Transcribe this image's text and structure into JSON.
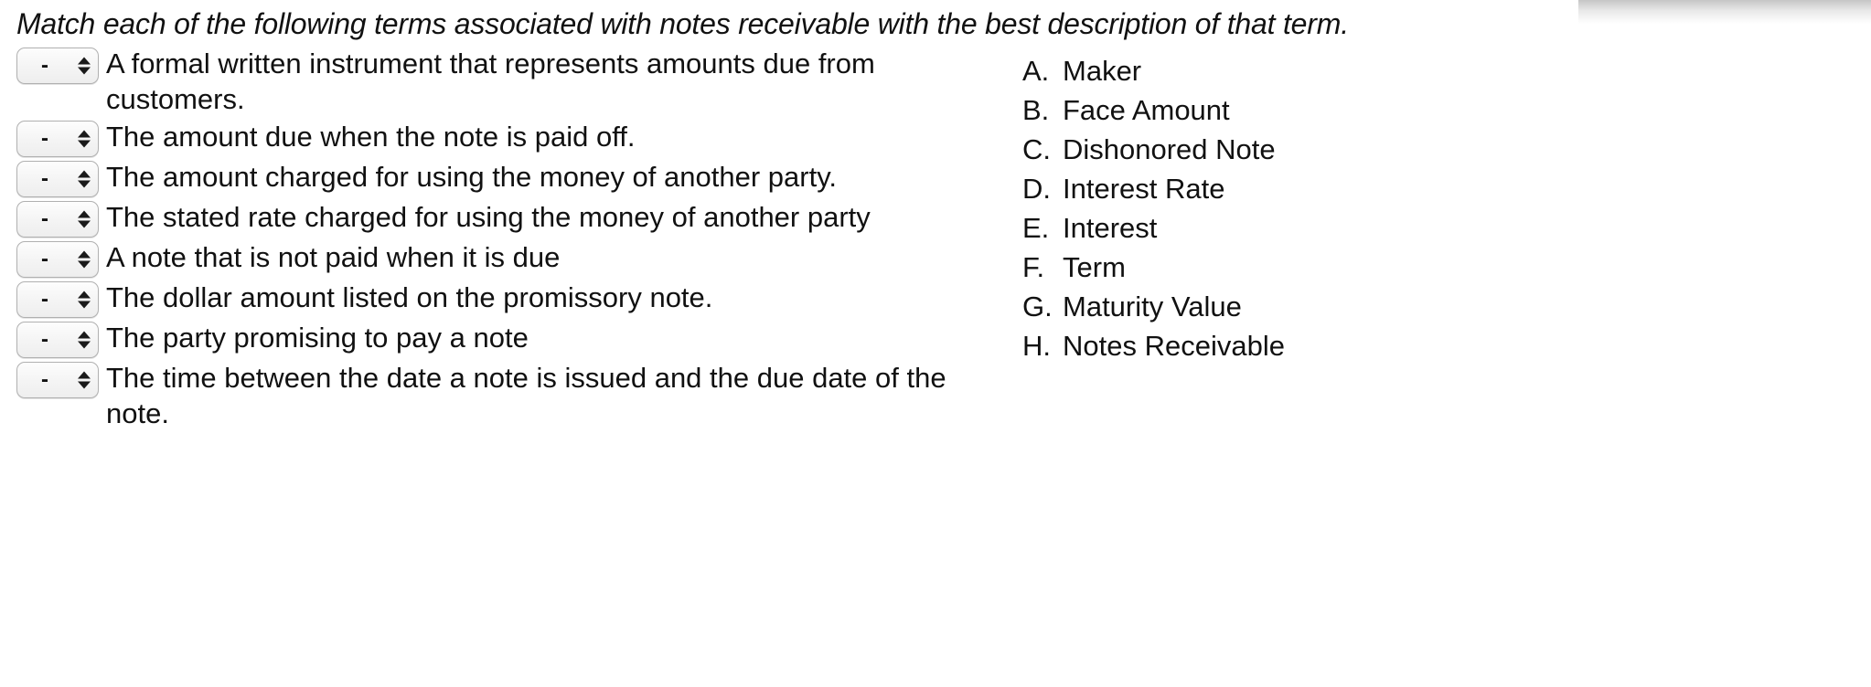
{
  "prompt": "Match each of the following terms associated with notes receivable with the best description of that term.",
  "select": {
    "selected_value": "-",
    "options": [
      "-",
      "A",
      "B",
      "C",
      "D",
      "E",
      "F",
      "G",
      "H"
    ],
    "up_arrow_icon": "triangle-up-icon",
    "down_arrow_icon": "triangle-down-icon"
  },
  "descriptions": [
    {
      "id": 1,
      "text": "A formal written instrument that represents amounts due from customers.",
      "answer": "-"
    },
    {
      "id": 2,
      "text": "The amount due when the note is paid off.",
      "answer": "-"
    },
    {
      "id": 3,
      "text": "The amount charged for using the money of another party.",
      "answer": "-"
    },
    {
      "id": 4,
      "text": "The stated rate charged for using the money of another party",
      "answer": "-"
    },
    {
      "id": 5,
      "text": "A note that is not paid when it is due",
      "answer": "-"
    },
    {
      "id": 6,
      "text": "The dollar amount listed on the promissory note.",
      "answer": "-"
    },
    {
      "id": 7,
      "text": "The party promising to pay a note",
      "answer": "-"
    },
    {
      "id": 8,
      "text": "The time between the date a note is issued and the due date of the note.",
      "answer": "-"
    }
  ],
  "terms": [
    {
      "letter": "A.",
      "label": "Maker"
    },
    {
      "letter": "B.",
      "label": "Face Amount"
    },
    {
      "letter": "C.",
      "label": "Dishonored Note"
    },
    {
      "letter": "D.",
      "label": "Interest Rate"
    },
    {
      "letter": "E.",
      "label": "Interest"
    },
    {
      "letter": "F.",
      "label": "Term"
    },
    {
      "letter": "G.",
      "label": "Maturity Value"
    },
    {
      "letter": "H.",
      "label": "Notes Receivable"
    }
  ],
  "colors": {
    "text": "#111111",
    "background": "#ffffff",
    "select_border": "#b0b0b0",
    "select_background": "#f4f4f4"
  }
}
